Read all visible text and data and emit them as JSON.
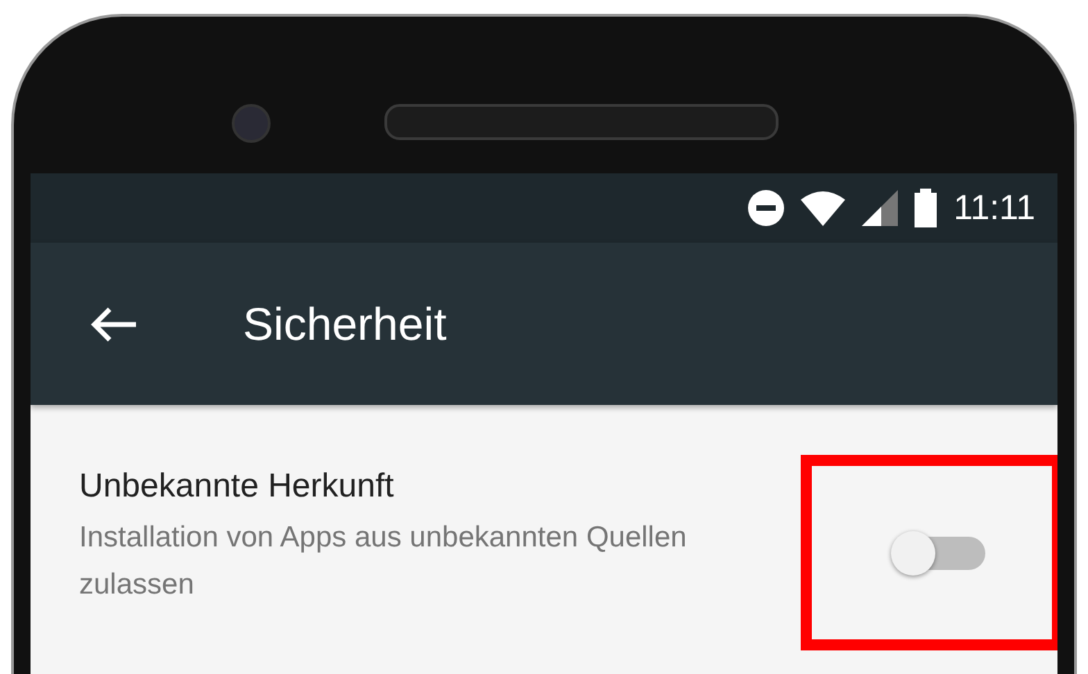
{
  "status_bar": {
    "time": "11:11"
  },
  "toolbar": {
    "title": "Sicherheit"
  },
  "settings": [
    {
      "title": "Unbekannte Herkunft",
      "subtitle": "Installation von Apps aus unbekannten Quellen zulassen",
      "on": false,
      "highlighted": true
    }
  ]
}
